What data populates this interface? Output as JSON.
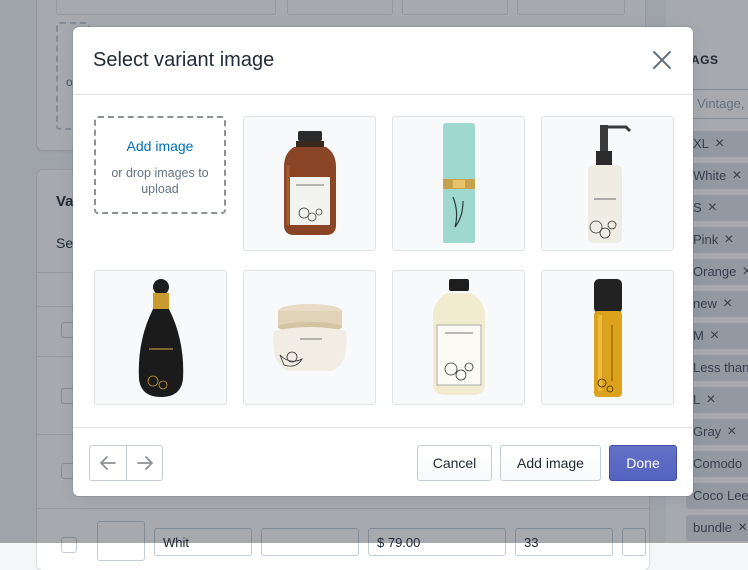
{
  "background": {
    "variants_heading": "Va",
    "select_label": "Sel",
    "drop_letter": "o",
    "variant_row": {
      "option1": "Whit",
      "price": "$ 79.00",
      "quantity": "33"
    },
    "tags_panel": {
      "title": "AGS",
      "input_placeholder": "Vintage, c",
      "tags": [
        "XL",
        "White",
        "S",
        "Pink",
        "Orange",
        "new",
        "M",
        "Less than",
        "L",
        "Gray",
        "Comodo",
        "Coco Lee",
        "bundle"
      ]
    }
  },
  "modal": {
    "title": "Select variant image",
    "dropzone": {
      "title": "Add image",
      "subtitle": "or drop images to upload"
    },
    "images": [
      {
        "icon": "amber-bottle-image"
      },
      {
        "icon": "mint-lipstick-image"
      },
      {
        "icon": "pump-bottle-image"
      },
      {
        "icon": "black-perfume-image"
      },
      {
        "icon": "ceramic-jar-image"
      },
      {
        "icon": "cream-bottle-image"
      },
      {
        "icon": "gold-serum-image"
      }
    ],
    "footer": {
      "cancel_label": "Cancel",
      "add_image_label": "Add image",
      "done_label": "Done"
    }
  },
  "colors": {
    "primary": "#5c6ac4",
    "link": "#006fbb",
    "overlay": "rgba(33,43,54,0.4)"
  }
}
